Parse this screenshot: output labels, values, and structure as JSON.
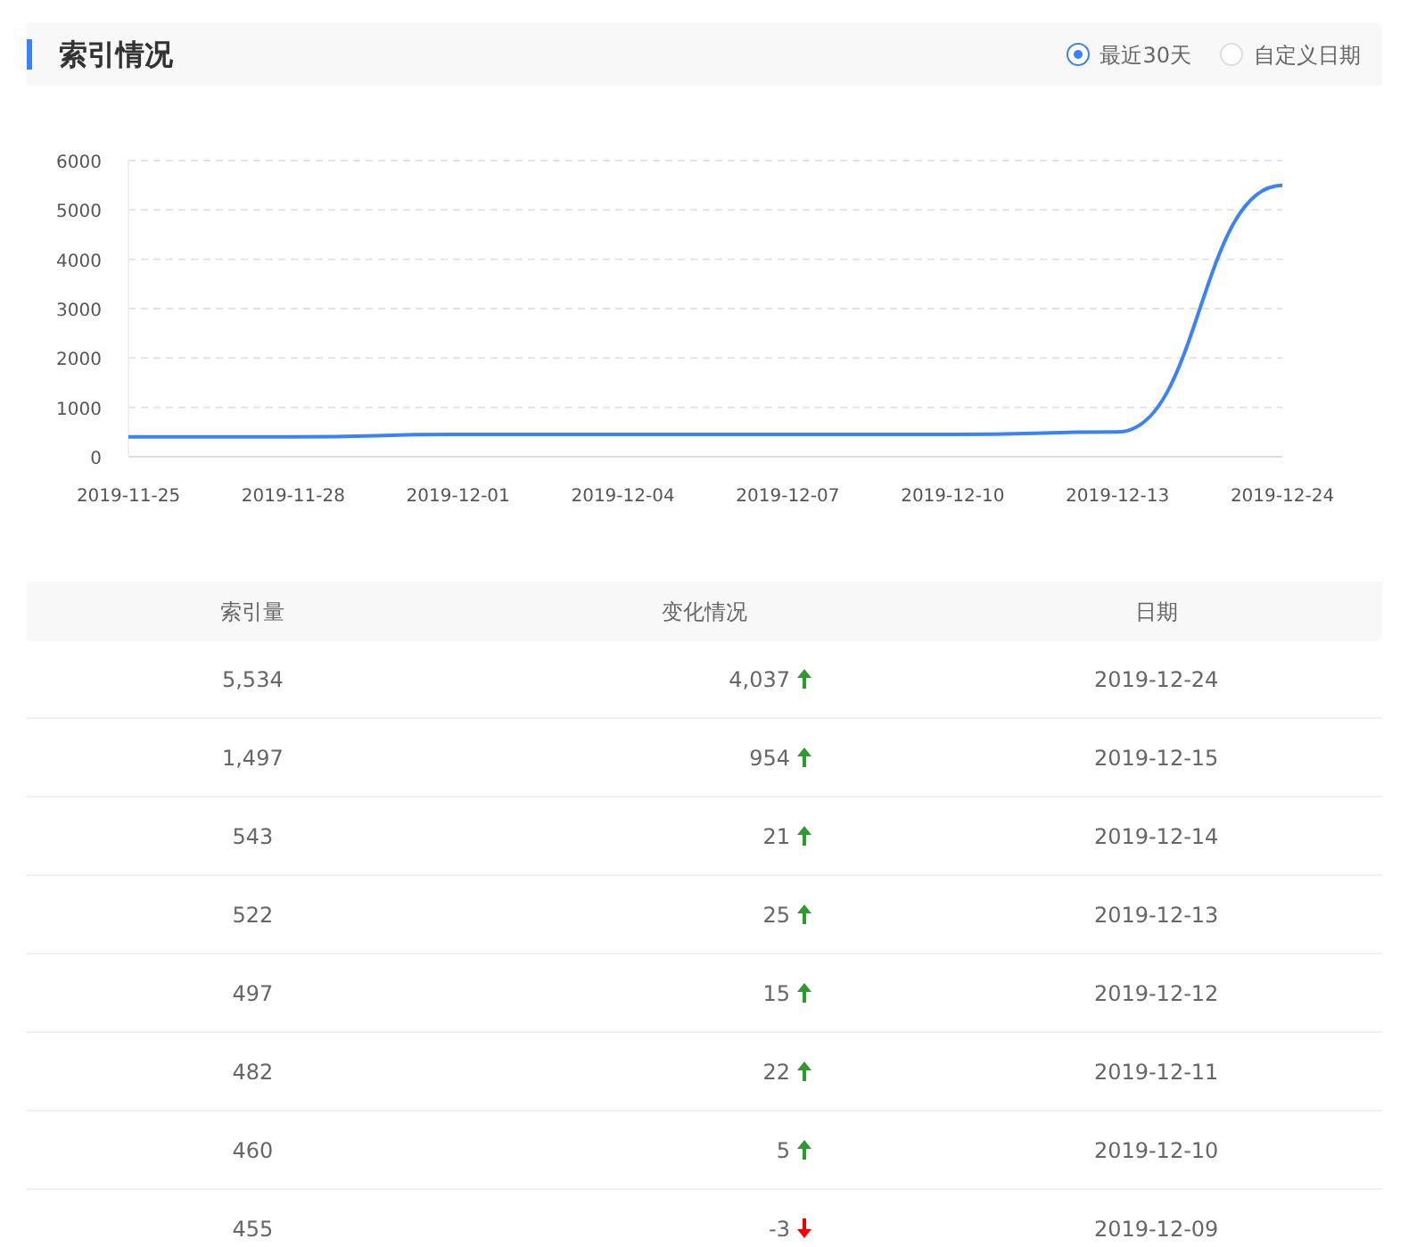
{
  "header": {
    "title": "索引情况",
    "range_options": [
      {
        "label": "最近30天",
        "selected": true
      },
      {
        "label": "自定义日期",
        "selected": false
      }
    ]
  },
  "chart": {
    "chart_data": {
      "type": "line",
      "categories": [
        "2019-11-25",
        "2019-11-28",
        "2019-12-01",
        "2019-12-04",
        "2019-12-07",
        "2019-12-10",
        "2019-12-13",
        "2019-12-24"
      ],
      "series": [
        {
          "color": "#3b82f6",
          "values": [
            400,
            400,
            450,
            450,
            450,
            450,
            500,
            5500
          ]
        }
      ],
      "ylim": [
        0,
        6000
      ],
      "yticks": [
        0,
        1000,
        2000,
        3000,
        4000,
        5000,
        6000
      ],
      "grid": true
    }
  },
  "table": {
    "columns": [
      "索引量",
      "变化情况",
      "日期"
    ],
    "rows": [
      {
        "count": "5,534",
        "change": "4,037",
        "increase": true,
        "date": "2019-12-24"
      },
      {
        "count": "1,497",
        "change": "954",
        "increase": true,
        "date": "2019-12-15"
      },
      {
        "count": "543",
        "change": "21",
        "increase": true,
        "date": "2019-12-14"
      },
      {
        "count": "522",
        "change": "25",
        "increase": true,
        "date": "2019-12-13"
      },
      {
        "count": "497",
        "change": "15",
        "increase": true,
        "date": "2019-12-12"
      },
      {
        "count": "482",
        "change": "22",
        "increase": true,
        "date": "2019-12-11"
      },
      {
        "count": "460",
        "change": "5",
        "increase": true,
        "date": "2019-12-10"
      },
      {
        "count": "455",
        "change": "-3",
        "increase": false,
        "date": "2019-12-09"
      }
    ]
  }
}
